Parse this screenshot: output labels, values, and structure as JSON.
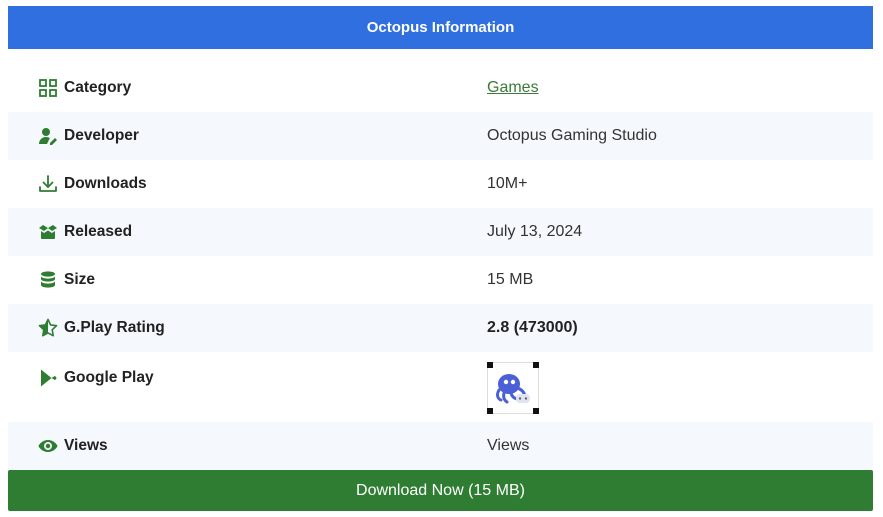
{
  "header": {
    "title": "Octopus Information"
  },
  "rows": [
    {
      "label": "Category",
      "value": "Games",
      "icon": "grid-icon"
    },
    {
      "label": "Developer",
      "value": "Octopus Gaming Studio",
      "icon": "user-edit-icon"
    },
    {
      "label": "Downloads",
      "value": "10M+",
      "icon": "download-icon"
    },
    {
      "label": "Released",
      "value": "July 13, 2024",
      "icon": "box-open-icon"
    },
    {
      "label": "Size",
      "value": "15 MB",
      "icon": "database-icon"
    },
    {
      "label": "G.Play Rating",
      "value": "2.8 (473000)",
      "icon": "star-half-icon"
    },
    {
      "label": "Google Play",
      "icon": "google-play-icon"
    },
    {
      "label": "Views",
      "value": "Views",
      "icon": "eye-icon"
    }
  ],
  "download_button": {
    "label": "Download Now (15 MB)"
  },
  "colors": {
    "header": "#2f6fdf",
    "icon": "#2e7d32",
    "button": "#2e7d32",
    "link": "#3b7a38"
  }
}
